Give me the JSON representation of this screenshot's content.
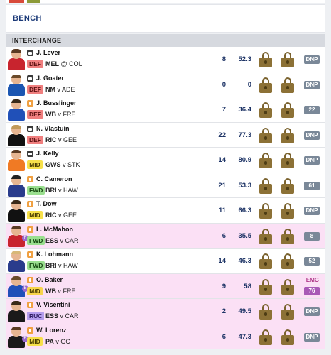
{
  "bench": {
    "title": "BENCH"
  },
  "interchange": {
    "title": "INTERCHANGE"
  },
  "icons": {
    "status_locked": "lock-badge-icon",
    "status_upcoming": "orange-badge-icon",
    "lock": "padlock-icon"
  },
  "colors": {
    "DEF": "#f07f7f",
    "MID": "#f7e04a",
    "FWD": "#9adf8f",
    "RUC": "#b49cec",
    "highlight_row": "#fbe0f5",
    "dnp_tag": "#7a8898",
    "emg_tag": "#a85ab6"
  },
  "players": [
    {
      "name": "J. Lever",
      "pos": "DEF",
      "team": "MEL",
      "sep": "@",
      "opp": "COL",
      "stat1": "8",
      "stat2": "52.3",
      "tag": "DNP",
      "status": "locked",
      "highlight": false,
      "kit": "#c8242e",
      "hair": "#5a3a22"
    },
    {
      "name": "J. Goater",
      "pos": "DEF",
      "team": "NM",
      "sep": "v",
      "opp": "ADE",
      "stat1": "0",
      "stat2": "0",
      "tag": "DNP",
      "status": "locked",
      "highlight": false,
      "kit": "#1b56b2",
      "hair": "#6a4a2a"
    },
    {
      "name": "J. Busslinger",
      "pos": "DEF",
      "team": "WB",
      "sep": "v",
      "opp": "FRE",
      "stat1": "7",
      "stat2": "36.4",
      "tag": "22",
      "status": "upcoming",
      "highlight": false,
      "kit": "#2050b8",
      "hair": "#3a2a18"
    },
    {
      "name": "N. Vlastuin",
      "pos": "DEF",
      "team": "RIC",
      "sep": "v",
      "opp": "GEE",
      "stat1": "22",
      "stat2": "77.3",
      "tag": "DNP",
      "status": "locked",
      "highlight": false,
      "kit": "#111111",
      "hair": "#c29a5a"
    },
    {
      "name": "J. Kelly",
      "pos": "MID",
      "team": "GWS",
      "sep": "v",
      "opp": "STK",
      "stat1": "14",
      "stat2": "80.9",
      "tag": "DNP",
      "status": "locked",
      "highlight": false,
      "kit": "#f07a24",
      "hair": "#5a3a22"
    },
    {
      "name": "C. Cameron",
      "pos": "FWD",
      "team": "BRI",
      "sep": "v",
      "opp": "HAW",
      "stat1": "21",
      "stat2": "53.3",
      "tag": "61",
      "status": "upcoming",
      "highlight": false,
      "kit": "#2a3c8c",
      "hair": "#222222"
    },
    {
      "name": "T. Dow",
      "pos": "MID",
      "team": "RIC",
      "sep": "v",
      "opp": "GEE",
      "stat1": "11",
      "stat2": "66.3",
      "tag": "DNP",
      "status": "upcoming",
      "highlight": false,
      "kit": "#111111",
      "hair": "#3a2a18"
    },
    {
      "name": "L. McMahon",
      "pos": "FWD",
      "team": "ESS",
      "sep": "v",
      "opp": "CAR",
      "stat1": "6",
      "stat2": "35.5",
      "tag": "8",
      "status": "upcoming",
      "highlight": true,
      "kit": "#c8242e",
      "hair": "#5a3a22",
      "circle": "F"
    },
    {
      "name": "K. Lohmann",
      "pos": "FWD",
      "team": "BRI",
      "sep": "v",
      "opp": "HAW",
      "stat1": "14",
      "stat2": "46.3",
      "tag": "52",
      "status": "upcoming",
      "highlight": false,
      "kit": "#2a3c8c",
      "hair": "#d8b878"
    },
    {
      "name": "O. Baker",
      "pos": "M/D",
      "team": "WB",
      "sep": "v",
      "opp": "FRE",
      "stat1": "9",
      "stat2": "58",
      "tag": "76",
      "emg": "EMG",
      "status": "upcoming",
      "highlight": true,
      "kit": "#2050b8",
      "hair": "#6a4a2a",
      "circle": "B"
    },
    {
      "name": "V. Visentini",
      "pos": "RUC",
      "team": "ESS",
      "sep": "v",
      "opp": "CAR",
      "stat1": "2",
      "stat2": "49.5",
      "tag": "DNP",
      "status": "upcoming",
      "highlight": true,
      "kit": "#1a1a1a",
      "hair": "#3a2a18"
    },
    {
      "name": "W. Lorenz",
      "pos": "MID",
      "team": "PA",
      "sep": "v",
      "opp": "GC",
      "stat1": "6",
      "stat2": "47.3",
      "tag": "DNP",
      "status": "upcoming",
      "highlight": true,
      "kit": "#1a1a1a",
      "hair": "#5a3a22",
      "circle": "B"
    }
  ]
}
